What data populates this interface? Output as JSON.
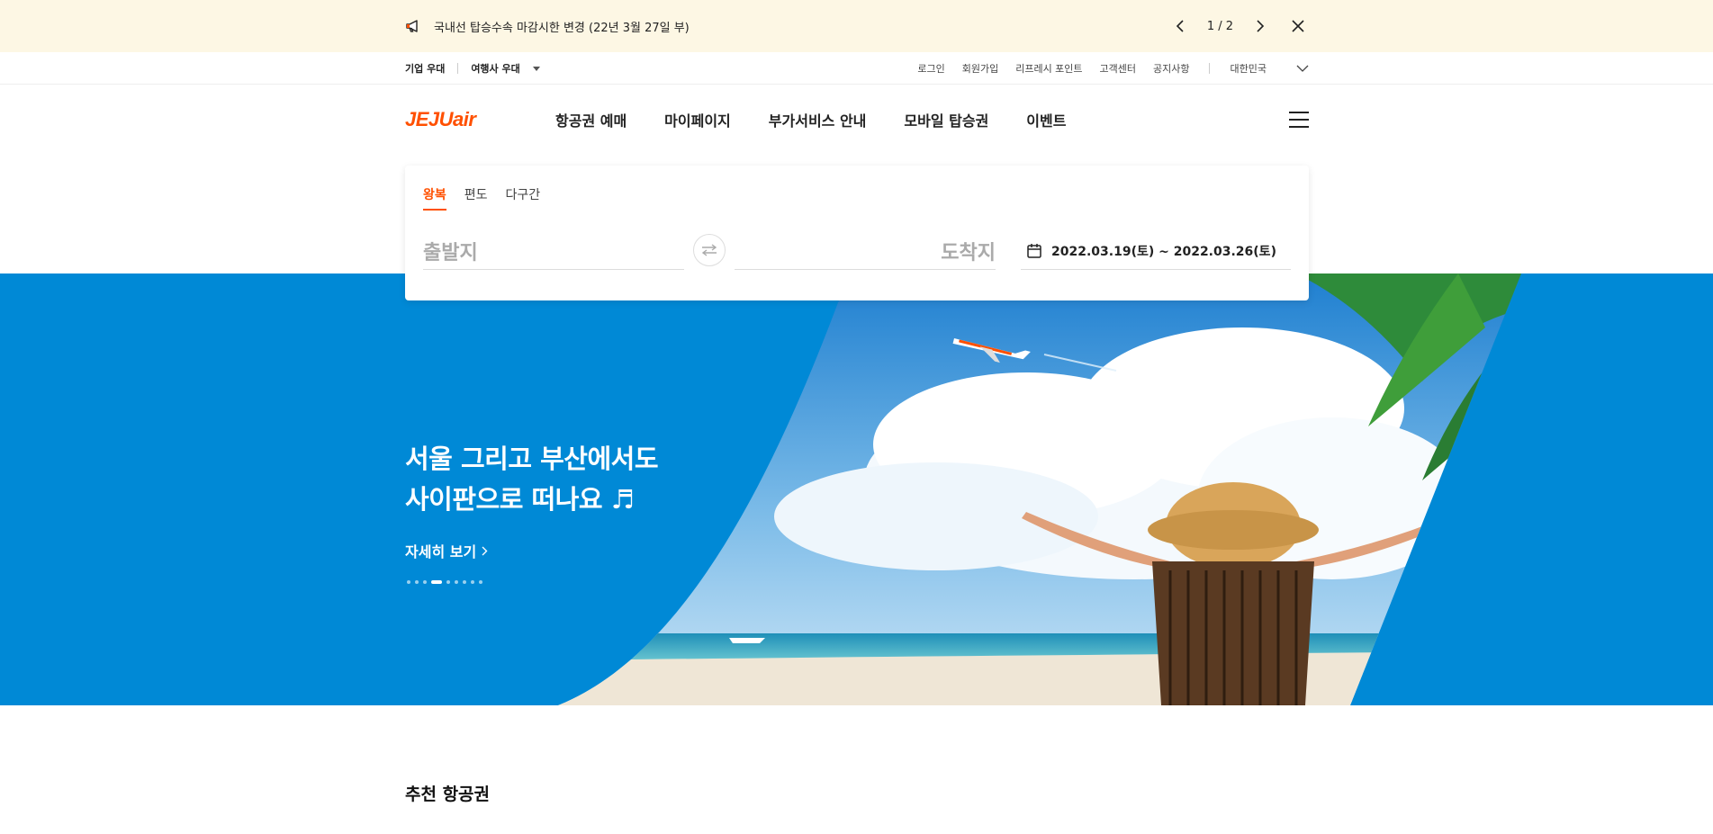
{
  "notice": {
    "text": "국내선 탑승수속 마감시한 변경 (22년 3월 27일 부)",
    "pager": "1 / 2",
    "icon": "megaphone-icon"
  },
  "util": {
    "left": [
      "기업 우대",
      "여행사 우대"
    ],
    "right": [
      "로그인",
      "회원가입",
      "리프레시 포인트",
      "고객센터",
      "공지사항"
    ],
    "region": "대한민국"
  },
  "gnb": {
    "logo": "JEJUair",
    "menu": [
      "항공권 예매",
      "마이페이지",
      "부가서비스 안내",
      "모바일 탑승권",
      "이벤트"
    ]
  },
  "booking": {
    "tabs": [
      "왕복",
      "편도",
      "다구간"
    ],
    "active_tab": "왕복",
    "departure_placeholder": "출발지",
    "arrival_placeholder": "도착지",
    "dates": "2022.03.19(토) ~ 2022.03.26(토)"
  },
  "hero": {
    "title_line1": "서울 그리고 부산에서도",
    "title_line2": "사이판으로 떠나요 ♬",
    "link": "자세히 보기",
    "slide_count": 9,
    "active_slide": 4
  },
  "colors": {
    "brand": "#ff5000",
    "hero_bg": "#0089d6",
    "notice_bg": "#fdf7e4"
  },
  "recommend": {
    "title": "추천 항공권"
  }
}
